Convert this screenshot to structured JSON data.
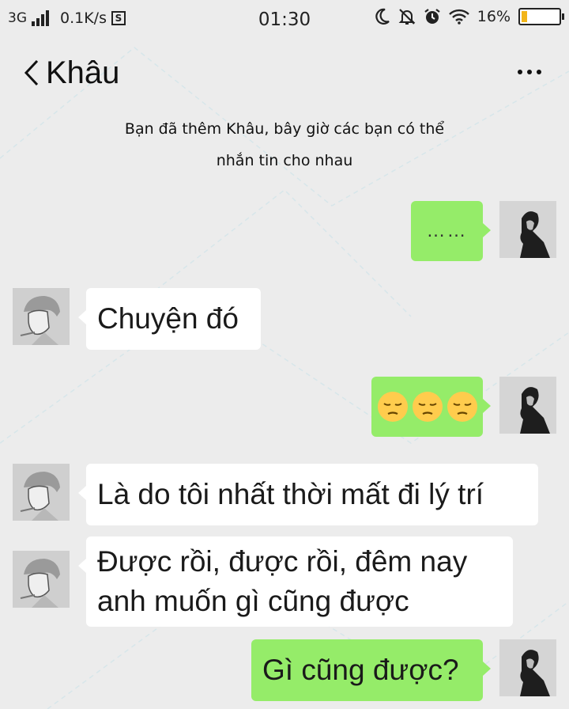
{
  "status_bar": {
    "network": "3G",
    "speed": "0.1K/s",
    "time": "01:30",
    "battery": "16%"
  },
  "header": {
    "title": "Khâu"
  },
  "system_message": {
    "line1": "Bạn đã thêm Khâu, bây giờ các bạn có thể",
    "line2": "nhắn tin cho nhau"
  },
  "messages": [
    {
      "side": "right",
      "text": "……"
    },
    {
      "side": "left",
      "text": "Chuyện đó"
    },
    {
      "side": "right",
      "type": "emoji",
      "emoji": [
        "pensive-face",
        "pensive-face",
        "pensive-face"
      ]
    },
    {
      "side": "left",
      "text": "Là do tôi nhất thời mất đi lý trí"
    },
    {
      "side": "left",
      "line1": "Được rồi, được rồi, đêm nay",
      "line2": "anh muốn gì cũng được"
    },
    {
      "side": "right",
      "text": "Gì cũng được?"
    }
  ],
  "colors": {
    "background": "#ececec",
    "bubble_right": "#95ec69",
    "bubble_left": "#ffffff",
    "battery_fill": "#f2b51a"
  },
  "icons": [
    "signal-icon",
    "sd-card-icon",
    "moon-icon",
    "mute-bell-icon",
    "alarm-icon",
    "wifi-icon",
    "battery-icon",
    "back-chevron-icon",
    "more-dots-icon",
    "pensive-face-emoji"
  ]
}
